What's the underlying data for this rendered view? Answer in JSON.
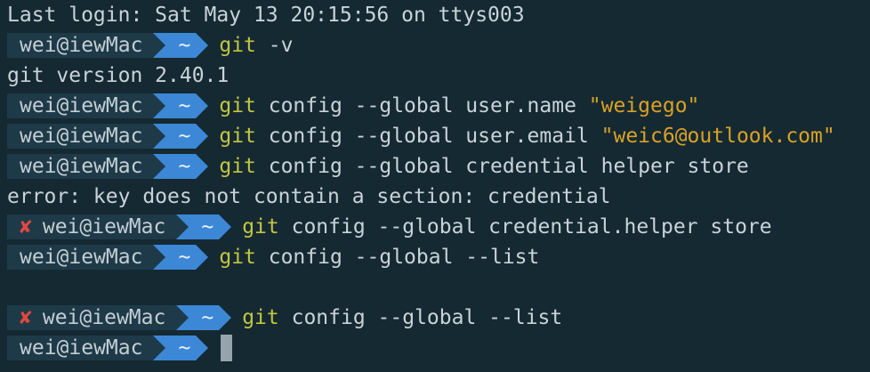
{
  "terminal": {
    "login_line": "Last login: Sat May 13 20:15:56 on ttys003",
    "prompt_context": "wei@iewMac",
    "prompt_dir": "~",
    "error_mark": "✘",
    "lines": [
      {
        "kind": "prompt",
        "error": false,
        "git": "git",
        "args": " -v",
        "str": ""
      },
      {
        "kind": "output",
        "text": "git version 2.40.1"
      },
      {
        "kind": "prompt",
        "error": false,
        "git": "git",
        "args": " config --global user.name ",
        "str": "\"weigego\""
      },
      {
        "kind": "prompt",
        "error": false,
        "git": "git",
        "args": " config --global user.email ",
        "str": "\"weic6@outlook.com\""
      },
      {
        "kind": "prompt",
        "error": false,
        "git": "git",
        "args": " config --global credential helper store",
        "str": ""
      },
      {
        "kind": "output",
        "text": "error: key does not contain a section: credential"
      },
      {
        "kind": "prompt",
        "error": true,
        "git": "git",
        "args": " config --global credential.helper store",
        "str": ""
      },
      {
        "kind": "prompt",
        "error": false,
        "git": "git",
        "args": " config --global --list",
        "str": ""
      },
      {
        "kind": "blank"
      },
      {
        "kind": "prompt",
        "error": true,
        "git": "git",
        "args": " config --global --list",
        "str": ""
      },
      {
        "kind": "current",
        "error": false
      }
    ]
  },
  "colors": {
    "background": "#152933",
    "context_bg": "#1e3a48",
    "dir_bg": "#3c88d6",
    "git_keyword": "#c2c640",
    "string": "#d9a224",
    "error": "#e2483f"
  }
}
